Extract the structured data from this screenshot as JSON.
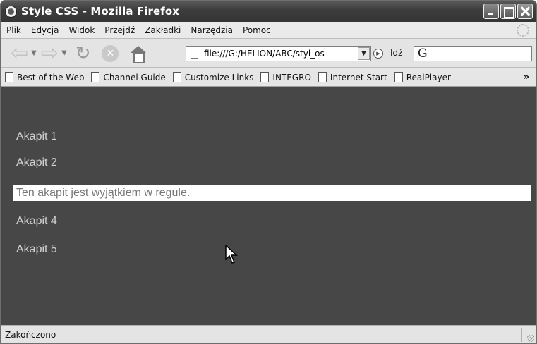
{
  "window": {
    "title": "Style CSS - Mozilla Firefox"
  },
  "menu": {
    "items": [
      "Plik",
      "Edycja",
      "Widok",
      "Przejdź",
      "Zakładki",
      "Narzędzia",
      "Pomoc"
    ]
  },
  "nav": {
    "url": "file:///G:/HELION/ABC/styl_os",
    "go_label": "Idź",
    "search_value": ""
  },
  "bookmarks": {
    "items": [
      "Best of the Web",
      "Channel Guide",
      "Customize Links",
      "INTEGRO",
      "Internet Start",
      "RealPlayer"
    ],
    "more": "»"
  },
  "content": {
    "paragraphs": [
      "Akapit 1",
      "Akapit 2",
      "Ten akapit jest wyjątkiem w regule.",
      "Akapit 4",
      "Akapit 5"
    ]
  },
  "status": {
    "text": "Zakończono"
  },
  "colors": {
    "page_background": "#474747",
    "paragraph_text": "#d2d2d2",
    "highlight_background": "#ffffff"
  }
}
